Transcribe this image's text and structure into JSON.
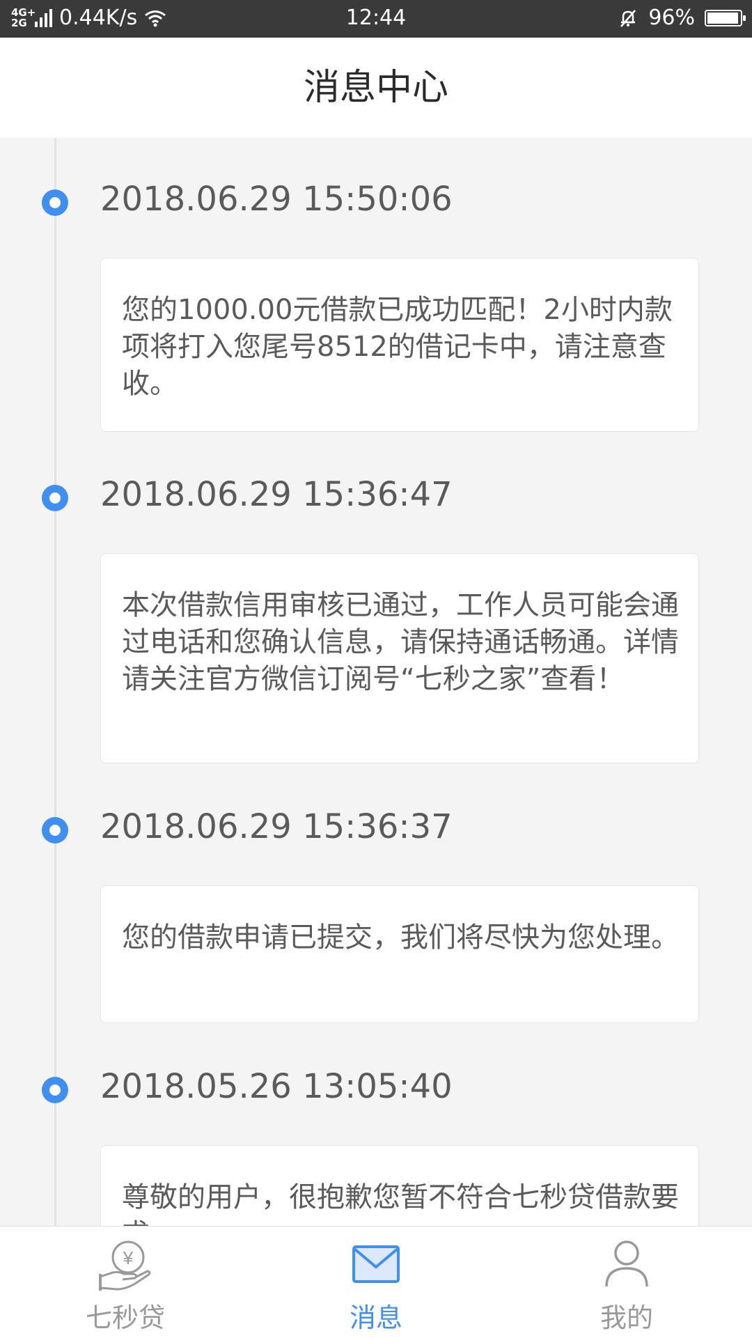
{
  "status_bar": {
    "network_label": "4G+ 2G",
    "speed": "0.44K/s",
    "time": "12:44",
    "battery": "96%",
    "battery_level": 0.96
  },
  "header": {
    "title": "消息中心"
  },
  "messages": [
    {
      "time": "2018.06.29 15:50:06",
      "text": "您的1000.00元借款已成功匹配！2小时内款项将打入您尾号8512的借记卡中，请注意查收。"
    },
    {
      "time": "2018.06.29 15:36:47",
      "text": "本次借款信用审核已通过，工作人员可能会通过电话和您确认信息，请保持通话畅通。详情请关注官方微信订阅号“七秒之家”查看！"
    },
    {
      "time": "2018.06.29 15:36:37",
      "text": "您的借款申请已提交，我们将尽快为您处理。"
    },
    {
      "time": "2018.05.26 13:05:40",
      "text": "尊敬的用户，很抱歉您暂不符合七秒贷借款要求。"
    }
  ],
  "tabs": [
    {
      "label": "七秒贷",
      "icon": "loan-hand-yen-icon",
      "active": false
    },
    {
      "label": "消息",
      "icon": "envelope-icon",
      "active": true
    },
    {
      "label": "我的",
      "icon": "person-icon",
      "active": false
    }
  ],
  "colors": {
    "accent": "#3f8ef1",
    "inactive": "#999999",
    "background": "#f4f4f4"
  }
}
